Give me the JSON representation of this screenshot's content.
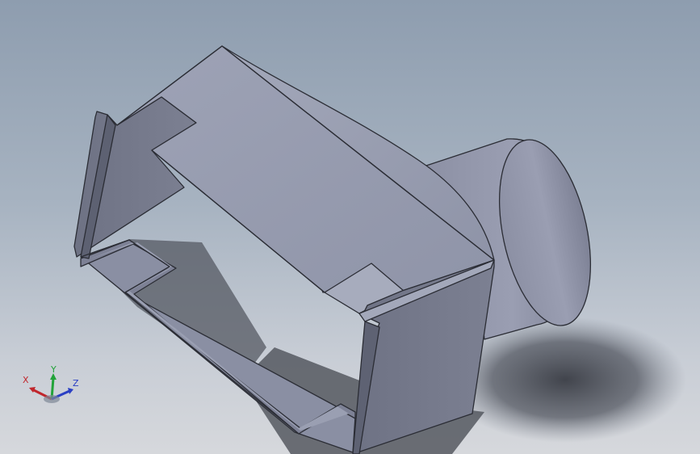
{
  "viewport": {
    "colors": {
      "background_top": "#8e9daf",
      "background_bottom": "#d6d8dc",
      "model_face_light": "#969baf",
      "model_face_dark": "#6e7284",
      "model_edge": "#2b2d35"
    }
  },
  "triad": {
    "x_label": "X",
    "y_label": "Y",
    "z_label": "Z",
    "colors": {
      "x": "#c0262c",
      "y": "#22a33a",
      "z": "#2a3fc4"
    }
  }
}
